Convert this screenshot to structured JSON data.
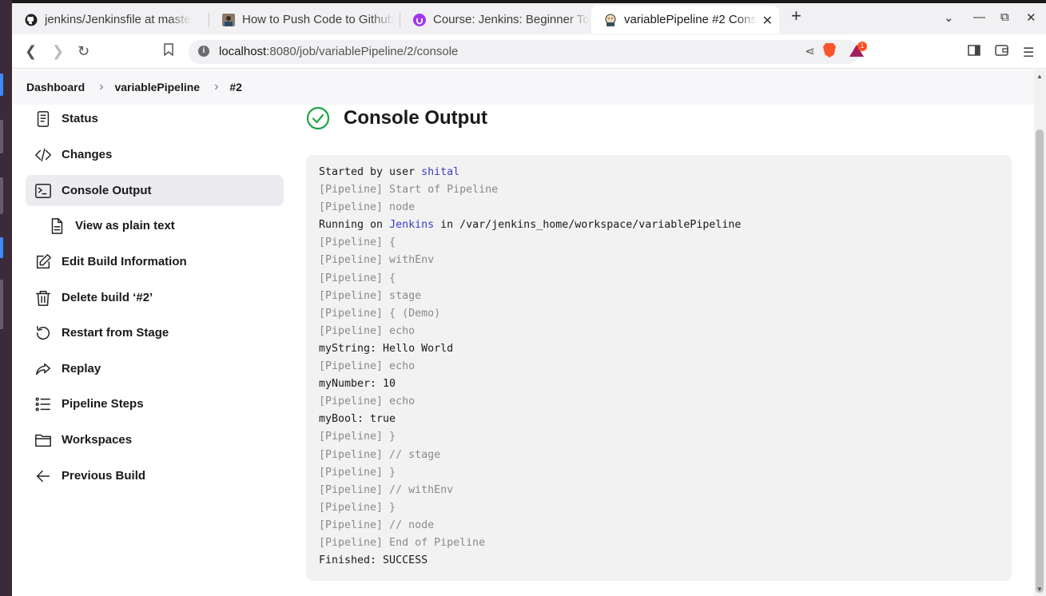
{
  "browser": {
    "tabs": [
      {
        "title": "jenkins/Jenkinsfile at maste",
        "favicon": "github-icon"
      },
      {
        "title": "How to Push Code to Github",
        "favicon": "avatar-icon"
      },
      {
        "title": "Course: Jenkins: Beginner To",
        "favicon": "udemy-icon"
      },
      {
        "title": "variablePipeline #2 Cons",
        "favicon": "jenkins-icon",
        "active": true
      }
    ],
    "url_host": "localhost",
    "url_rest": ":8080/job/variablePipeline/2/console",
    "notification_count": "1"
  },
  "breadcrumb": {
    "items": [
      "Dashboard",
      "variablePipeline",
      "#2"
    ]
  },
  "sidebar": {
    "items": [
      {
        "label": "Status",
        "icon": "status-icon"
      },
      {
        "label": "Changes",
        "icon": "code-icon"
      },
      {
        "label": "Console Output",
        "icon": "terminal-icon",
        "active": true
      },
      {
        "label": "View as plain text",
        "icon": "document-icon",
        "sub": true
      },
      {
        "label": "Edit Build Information",
        "icon": "edit-icon"
      },
      {
        "label": "Delete build ‘#2’",
        "icon": "trash-icon"
      },
      {
        "label": "Restart from Stage",
        "icon": "restart-icon"
      },
      {
        "label": "Replay",
        "icon": "replay-icon"
      },
      {
        "label": "Pipeline Steps",
        "icon": "steps-icon"
      },
      {
        "label": "Workspaces",
        "icon": "folder-icon"
      },
      {
        "label": "Previous Build",
        "icon": "arrow-left-icon"
      }
    ]
  },
  "main": {
    "title": "Console Output",
    "status_color": "#1ea446",
    "console": {
      "started_prefix": "Started by user ",
      "user": "shital",
      "running_prefix": "Running on ",
      "node": "Jenkins",
      "running_suffix": " in /var/jenkins_home/workspace/variablePipeline",
      "lines": [
        {
          "text": "[Pipeline] Start of Pipeline",
          "dim": true
        },
        {
          "text": "[Pipeline] node",
          "dim": true
        },
        {
          "text": "[Pipeline] {",
          "dim": true
        },
        {
          "text": "[Pipeline] withEnv",
          "dim": true
        },
        {
          "text": "[Pipeline] {",
          "dim": true
        },
        {
          "text": "[Pipeline] stage",
          "dim": true
        },
        {
          "text": "[Pipeline] { (Demo)",
          "dim": true
        },
        {
          "text": "[Pipeline] echo",
          "dim": true
        },
        {
          "text": "myString: Hello World",
          "dim": false
        },
        {
          "text": "[Pipeline] echo",
          "dim": true
        },
        {
          "text": "myNumber: 10",
          "dim": false
        },
        {
          "text": "[Pipeline] echo",
          "dim": true
        },
        {
          "text": "myBool: true",
          "dim": false
        },
        {
          "text": "[Pipeline] }",
          "dim": true
        },
        {
          "text": "[Pipeline] // stage",
          "dim": true
        },
        {
          "text": "[Pipeline] }",
          "dim": true
        },
        {
          "text": "[Pipeline] // withEnv",
          "dim": true
        },
        {
          "text": "[Pipeline] }",
          "dim": true
        },
        {
          "text": "[Pipeline] // node",
          "dim": true
        },
        {
          "text": "[Pipeline] End of Pipeline",
          "dim": true
        },
        {
          "text": "Finished: SUCCESS",
          "dim": false
        }
      ]
    }
  }
}
